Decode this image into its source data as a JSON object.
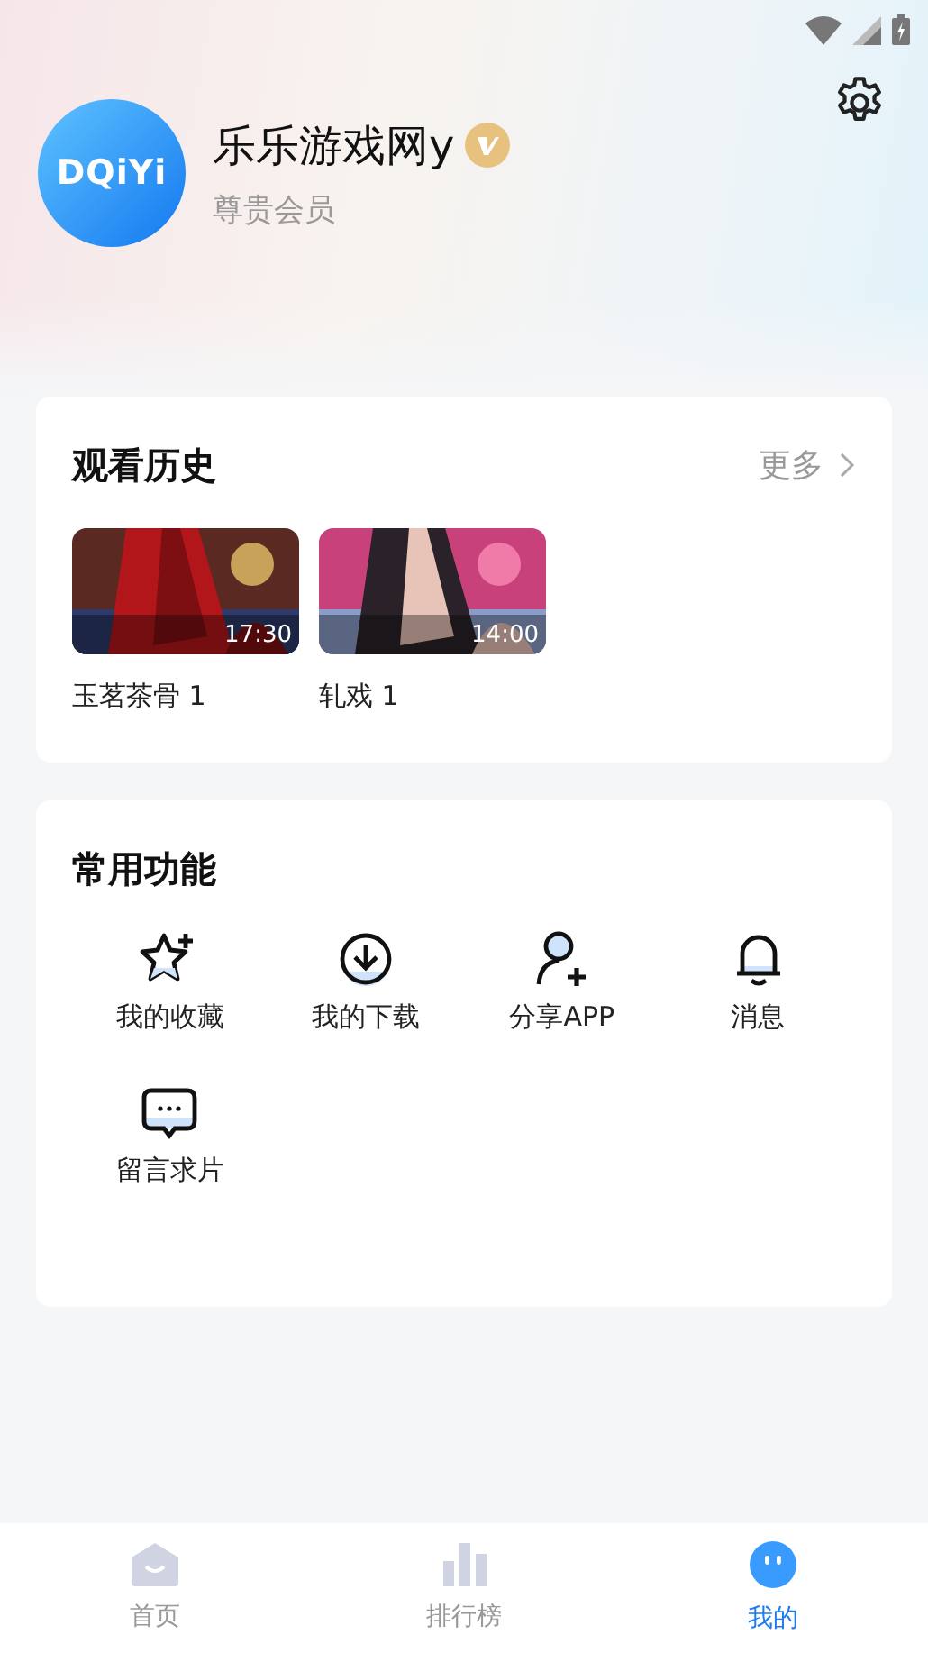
{
  "profile": {
    "avatar_text": "DQiYi",
    "name": "乐乐游戏网y",
    "verified": true,
    "level": "尊贵会员"
  },
  "history": {
    "title": "观看历史",
    "more": "更多",
    "items": [
      {
        "title": "玉茗茶骨 1",
        "duration": "17:30"
      },
      {
        "title": "轧戏 1",
        "duration": "14:00"
      }
    ]
  },
  "functions": {
    "title": "常用功能",
    "items": [
      {
        "label": "我的收藏",
        "kind": "favorite"
      },
      {
        "label": "我的下载",
        "kind": "download"
      },
      {
        "label": "分享APP",
        "kind": "share"
      },
      {
        "label": "消息",
        "kind": "message"
      },
      {
        "label": "留言求片",
        "kind": "request"
      }
    ]
  },
  "tabs": [
    {
      "label": "首页",
      "kind": "home",
      "selected": false
    },
    {
      "label": "排行榜",
      "kind": "ranking",
      "selected": false
    },
    {
      "label": "我的",
      "kind": "mine",
      "selected": true
    }
  ]
}
